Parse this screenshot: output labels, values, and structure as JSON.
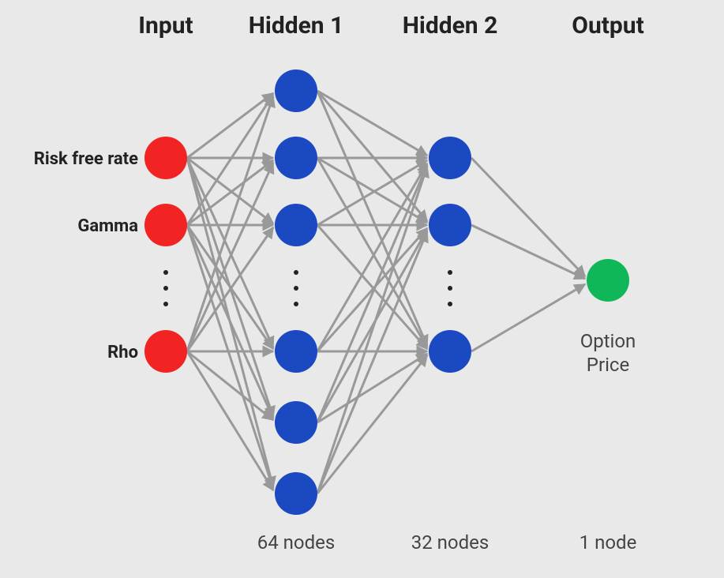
{
  "headers": {
    "input": "Input",
    "hidden1": "Hidden 1",
    "hidden2": "Hidden 2",
    "output": "Output"
  },
  "footers": {
    "hidden1": "64 nodes",
    "hidden2": "32 nodes",
    "output": "1 node"
  },
  "input_labels": {
    "risk_free_rate": "Risk free rate",
    "gamma": "Gamma",
    "rho": "Rho"
  },
  "output_label_line1": "Option",
  "output_label_line2": "Price",
  "colors": {
    "input_node": "#f22323",
    "hidden_node": "#1a49c2",
    "output_node": "#10b759",
    "edge": "#999999",
    "background": "#e9e9e9",
    "text": "#222222"
  },
  "architecture": {
    "input_nodes_shown": 3,
    "hidden1_nodes_total": 64,
    "hidden1_nodes_shown": 6,
    "hidden2_nodes_total": 32,
    "hidden2_nodes_shown": 3,
    "output_nodes_total": 1
  }
}
